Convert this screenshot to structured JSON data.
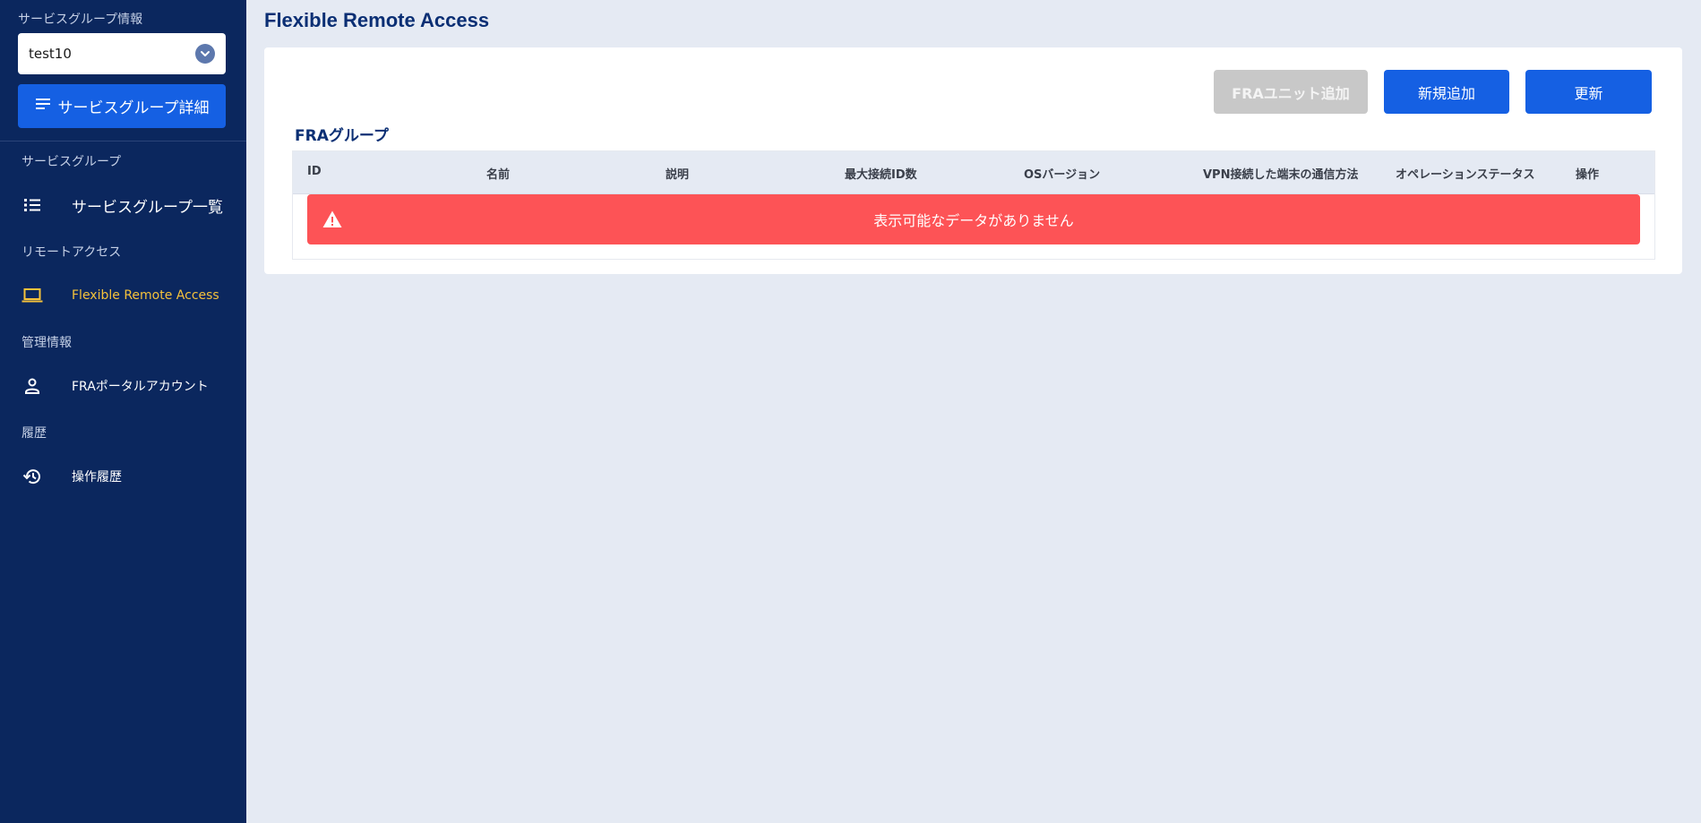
{
  "sidebar": {
    "service_group_info_label": "サービスグループ情報",
    "service_group_select": {
      "value": "test10"
    },
    "detail_button_label": "サービスグループ詳細",
    "sections": [
      {
        "label": "サービスグループ",
        "items": [
          {
            "label": "サービスグループ一覧",
            "icon": "list-icon"
          }
        ]
      },
      {
        "label": "リモートアクセス",
        "items": [
          {
            "label": "Flexible Remote Access",
            "icon": "laptop-icon",
            "active": true
          }
        ]
      },
      {
        "label": "管理情報",
        "items": [
          {
            "label": "FRAポータルアカウント",
            "icon": "person-icon"
          }
        ]
      },
      {
        "label": "履歴",
        "items": [
          {
            "label": "操作履歴",
            "icon": "history-icon"
          }
        ]
      }
    ],
    "active_color": "#f5c23b",
    "bg_color": "#0b275e"
  },
  "main": {
    "title": "Flexible Remote Access",
    "buttons": {
      "fra_unit_add": "FRAユニット追加",
      "new_add": "新規追加",
      "refresh": "更新"
    },
    "section_title": "FRAグループ",
    "table": {
      "columns": [
        "ID",
        "名前",
        "説明",
        "最大接続ID数",
        "OSバージョン",
        "VPN接続した端末の通信方法",
        "オペレーションステータス",
        "操作"
      ],
      "empty_message": "表示可能なデータがありません"
    },
    "colors": {
      "primary": "#1560e3",
      "alert": "#fd5356",
      "disabled": "#c8c8c8",
      "title": "#0b2f74"
    }
  }
}
